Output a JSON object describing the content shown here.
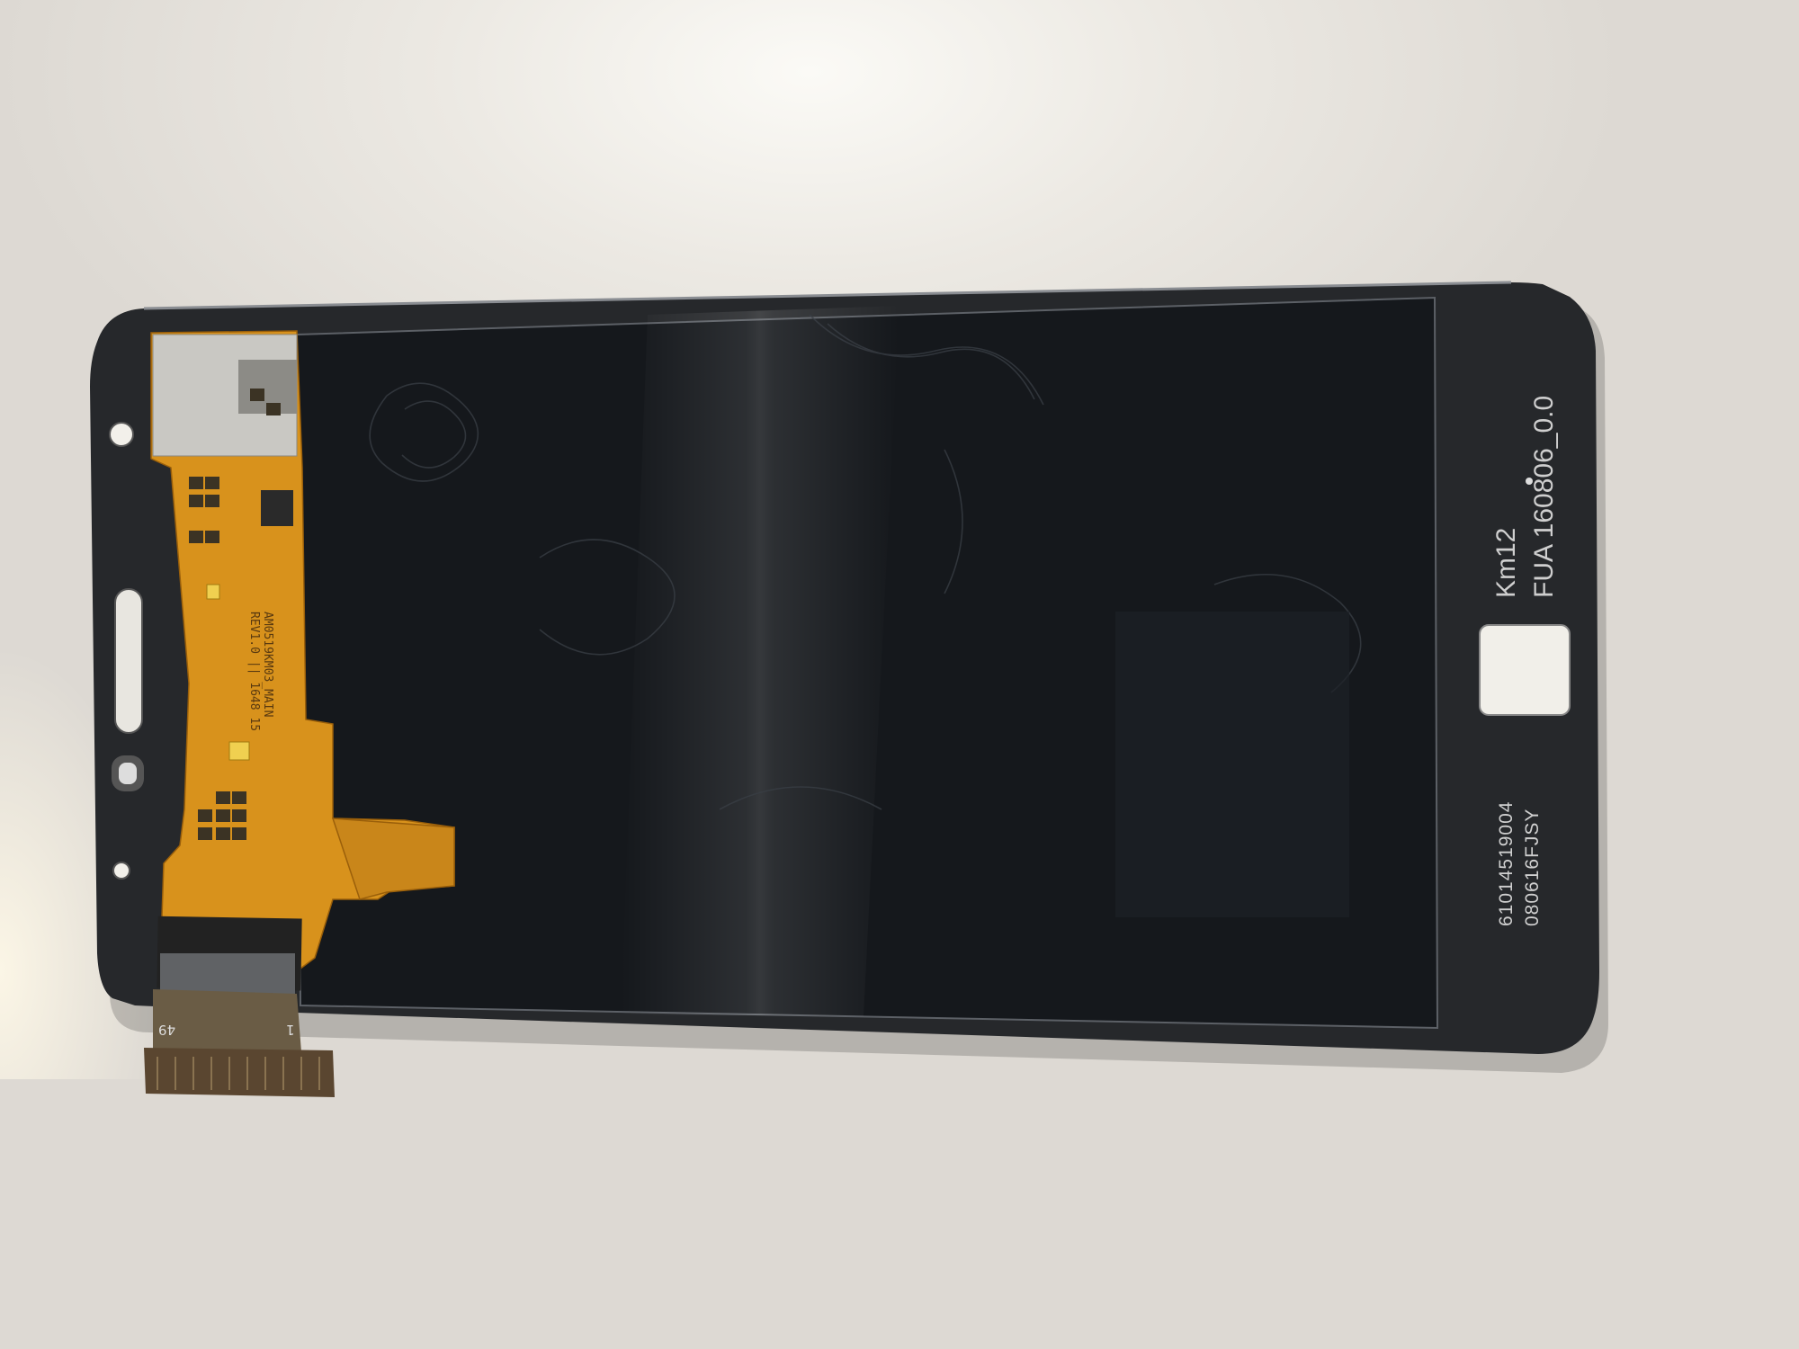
{
  "scene": {
    "colors": {
      "background": "#e4e1db",
      "panel_bezel": "#26282b",
      "screen": "#15181c",
      "flex_cable": "#d8921c",
      "print_text": "#cfcfcf"
    }
  },
  "panel": {
    "model_code": "Km12",
    "batch_code": "FUA 160806_0.0",
    "serial_number": "61014519004",
    "lot_code": "080616FJSY"
  },
  "flex_cable": {
    "part_label": "AM0519KM03_MAIN",
    "rev_label": "REV1.0 || 1648 15",
    "connector_pin_start": "1",
    "connector_pin_end": "49"
  }
}
